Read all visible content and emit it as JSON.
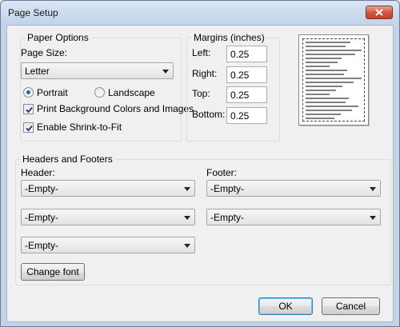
{
  "window": {
    "title": "Page Setup"
  },
  "paper_options": {
    "title": "Paper Options",
    "page_size_label": "Page Size:",
    "page_size_value": "Letter",
    "orientation": {
      "portrait": "Portrait",
      "landscape": "Landscape",
      "selected": "portrait"
    },
    "print_background": {
      "label": "Print Background Colors and Images",
      "checked": true
    },
    "shrink_to_fit": {
      "label": "Enable Shrink-to-Fit",
      "checked": true
    }
  },
  "margins": {
    "title": "Margins (inches)",
    "left_label": "Left:",
    "left_value": "0.25",
    "right_label": "Right:",
    "right_value": "0.25",
    "top_label": "Top:",
    "top_value": "0.25",
    "bottom_label": "Bottom:",
    "bottom_value": "0.25"
  },
  "headers_footers": {
    "title": "Headers and Footers",
    "header_label": "Header:",
    "footer_label": "Footer:",
    "header_1": "-Empty-",
    "header_2": "-Empty-",
    "header_3": "-Empty-",
    "footer_1": "-Empty-",
    "footer_2": "-Empty-",
    "change_font": "Change font"
  },
  "buttons": {
    "ok": "OK",
    "cancel": "Cancel"
  },
  "icons": {
    "close": "close-icon",
    "checkmark": "checkmark-icon",
    "dropdown": "chevron-down-icon"
  },
  "colors": {
    "accent": "#1f68c2",
    "close_button": "#d2583f"
  }
}
